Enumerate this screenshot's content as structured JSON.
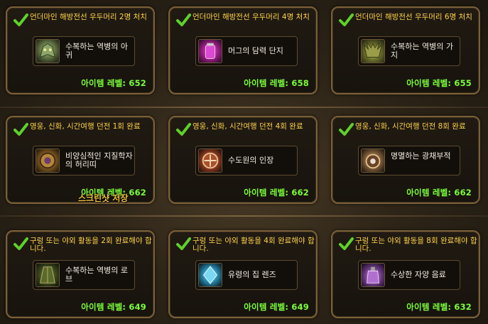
{
  "cards": [
    {
      "condition": "언더마인 해방전선 우두머리 2명 처치",
      "item": "수복하는 역병의 아귀",
      "level": "아이템 레벨: 652",
      "icon": "dragon-helm-icon"
    },
    {
      "condition": "언더마인 해방전선 우두머리 4명 처치",
      "item": "머그의 담력 단지",
      "level": "아이템 레벨: 658",
      "icon": "potion-jar-icon"
    },
    {
      "condition": "언더마인 해방전선 우두머리 6명 처치",
      "item": "수복하는 역병의 가지",
      "level": "아이템 레벨: 655",
      "icon": "antler-helm-icon"
    },
    {
      "condition": "영웅, 신화, 시간여행 던전 1회 완료",
      "item": "비양심적인 지질학자의 허리띠",
      "level": "아이템 레벨: 662",
      "icon": "belt-buckle-icon"
    },
    {
      "condition": "영웅, 신화, 시간여행 던전 4회 완료",
      "item": "수도원의 인장",
      "level": "아이템 레벨: 662",
      "icon": "seal-icon"
    },
    {
      "condition": "영웅, 신화, 시간여행 던전 8회 완료",
      "item": "명멸하는 광채부적",
      "level": "아이템 레벨: 662",
      "icon": "amulet-icon"
    },
    {
      "condition": "구렁 또는 야외 활동을 2회 완료해야 합니다.",
      "item": "수복하는 역병의 로브",
      "level": "아이템 레벨: 649",
      "icon": "robe-icon"
    },
    {
      "condition": "구렁 또는 야외 활동을 4회 완료해야 합니다.",
      "item": "유령의 집 렌즈",
      "level": "아이템 레벨: 649",
      "icon": "crystal-lens-icon"
    },
    {
      "condition": "구렁 또는 야외 활동을 8회 완료해야 합니다.",
      "item": "수상한 자양 음료",
      "level": "아이템 레벨: 632",
      "icon": "tonic-bottle-icon"
    }
  ],
  "toast": "스크린샷 저장",
  "colors": {
    "condition": "#ffd34a",
    "level": "#7cff3a",
    "check": "#5fd12a",
    "border": "#7a6038"
  }
}
